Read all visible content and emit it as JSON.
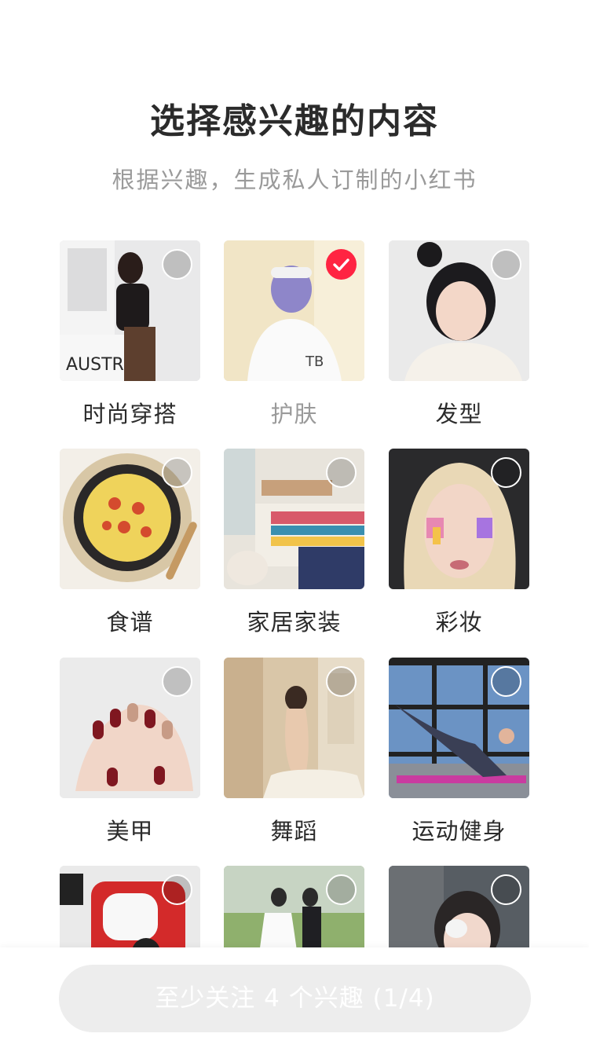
{
  "header": {
    "title": "选择感兴趣的内容",
    "subtitle": "根据兴趣，生成私人订制的小红书"
  },
  "topics": [
    {
      "label": "时尚穿搭",
      "selected": false
    },
    {
      "label": "护肤",
      "selected": true
    },
    {
      "label": "发型",
      "selected": false
    },
    {
      "label": "食谱",
      "selected": false
    },
    {
      "label": "家居家装",
      "selected": false
    },
    {
      "label": "彩妆",
      "selected": false
    },
    {
      "label": "美甲",
      "selected": false
    },
    {
      "label": "舞蹈",
      "selected": false
    },
    {
      "label": "运动健身",
      "selected": false
    },
    {
      "label": "",
      "selected": false
    },
    {
      "label": "",
      "selected": false
    },
    {
      "label": "",
      "selected": false
    }
  ],
  "footer": {
    "button_label": "至少关注 4 个兴趣 (1/4)"
  },
  "colors": {
    "accent": "#ff2442",
    "button_disabled": "#ededed"
  }
}
